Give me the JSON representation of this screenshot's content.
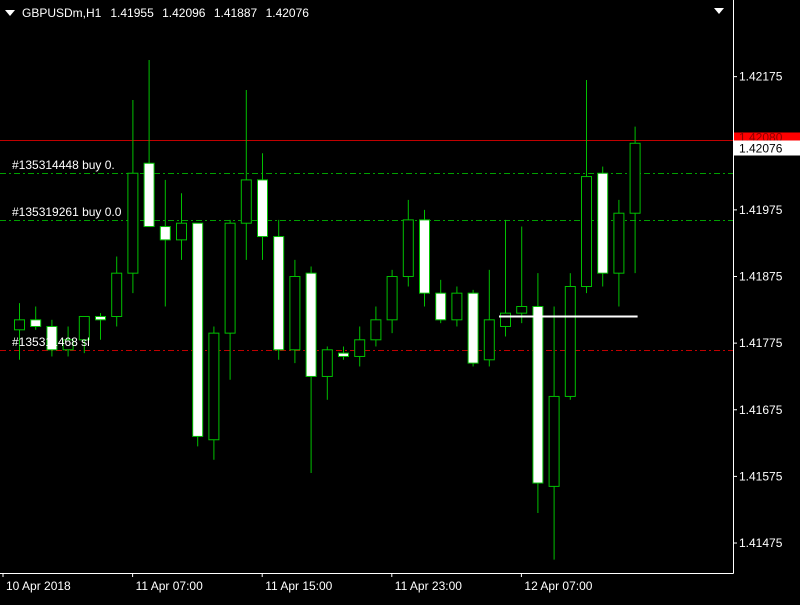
{
  "header": {
    "symbol": "GBPUSDm,H1",
    "open": "1.41955",
    "high": "1.42096",
    "low": "1.41887",
    "close": "1.42076"
  },
  "colors": {
    "background": "#000000",
    "candle_outline": "#00C000",
    "bull_body": "#000000",
    "bear_body": "#FFFFFF",
    "axis": "#FFFFFF",
    "order_line": "#00A000",
    "sl_line": "#C00000",
    "bid_line": "#C00000",
    "bid_label_bg": "#FF0000",
    "current_label_bg": "#FFFFFF"
  },
  "order_labels": [
    {
      "text": "#135314448 buy 0.",
      "line_price": 1.4203,
      "style": "order"
    },
    {
      "text": "#135319261 buy 0.0",
      "line_price": 1.4196,
      "style": "order"
    },
    {
      "text": "#135311468 sl",
      "line_price": 1.41765,
      "style": "sl"
    }
  ],
  "price_labels": {
    "bid": "1.42080",
    "current": "1.42076"
  },
  "chart_data": {
    "type": "candlestick",
    "symbol": "GBPUSDm",
    "timeframe": "H1",
    "y_ticks": [
      1.42175,
      1.42075,
      1.41975,
      1.41875,
      1.41775,
      1.41675,
      1.41575,
      1.41475
    ],
    "y_tick_labels": [
      "1.42175",
      "1.42075",
      "1.41975",
      "1.41875",
      "1.41775",
      "1.41675",
      "1.41575",
      "1.41475"
    ],
    "ylim": [
      1.4143,
      1.4226
    ],
    "x_labels": [
      {
        "label": "10 Apr 2018",
        "index": 0
      },
      {
        "label": "11 Apr 07:00",
        "index": 8
      },
      {
        "label": "11 Apr 15:00",
        "index": 16
      },
      {
        "label": "11 Apr 23:00",
        "index": 24
      },
      {
        "label": "12 Apr 07:00",
        "index": 32
      }
    ],
    "candles": [
      {
        "o": 1.41795,
        "h": 1.41835,
        "l": 1.4175,
        "c": 1.4181
      },
      {
        "o": 1.4181,
        "h": 1.4183,
        "l": 1.41795,
        "c": 1.418
      },
      {
        "o": 1.418,
        "h": 1.4181,
        "l": 1.41755,
        "c": 1.41765
      },
      {
        "o": 1.41765,
        "h": 1.418,
        "l": 1.41755,
        "c": 1.4178
      },
      {
        "o": 1.4178,
        "h": 1.41815,
        "l": 1.4176,
        "c": 1.41815
      },
      {
        "o": 1.41815,
        "h": 1.4182,
        "l": 1.4178,
        "c": 1.4181
      },
      {
        "o": 1.41815,
        "h": 1.41905,
        "l": 1.418,
        "c": 1.4188
      },
      {
        "o": 1.4188,
        "h": 1.4214,
        "l": 1.4185,
        "c": 1.4203
      },
      {
        "o": 1.42045,
        "h": 1.422,
        "l": 1.4195,
        "c": 1.4195
      },
      {
        "o": 1.4195,
        "h": 1.4202,
        "l": 1.4183,
        "c": 1.4193
      },
      {
        "o": 1.4193,
        "h": 1.42,
        "l": 1.419,
        "c": 1.41955
      },
      {
        "o": 1.41955,
        "h": 1.41955,
        "l": 1.4162,
        "c": 1.41635
      },
      {
        "o": 1.4163,
        "h": 1.418,
        "l": 1.416,
        "c": 1.4179
      },
      {
        "o": 1.4179,
        "h": 1.4196,
        "l": 1.4172,
        "c": 1.41955
      },
      {
        "o": 1.41955,
        "h": 1.42155,
        "l": 1.419,
        "c": 1.4202
      },
      {
        "o": 1.4202,
        "h": 1.4206,
        "l": 1.419,
        "c": 1.41935
      },
      {
        "o": 1.41935,
        "h": 1.4196,
        "l": 1.4175,
        "c": 1.41765
      },
      {
        "o": 1.41765,
        "h": 1.419,
        "l": 1.41745,
        "c": 1.41875
      },
      {
        "o": 1.4188,
        "h": 1.4189,
        "l": 1.4158,
        "c": 1.41725
      },
      {
        "o": 1.41725,
        "h": 1.4177,
        "l": 1.4169,
        "c": 1.41765
      },
      {
        "o": 1.4176,
        "h": 1.4177,
        "l": 1.4175,
        "c": 1.41755
      },
      {
        "o": 1.41755,
        "h": 1.418,
        "l": 1.4174,
        "c": 1.4178
      },
      {
        "o": 1.4178,
        "h": 1.4183,
        "l": 1.4177,
        "c": 1.4181
      },
      {
        "o": 1.4181,
        "h": 1.41885,
        "l": 1.4179,
        "c": 1.41875
      },
      {
        "o": 1.41875,
        "h": 1.4199,
        "l": 1.4186,
        "c": 1.4196
      },
      {
        "o": 1.4196,
        "h": 1.41975,
        "l": 1.4183,
        "c": 1.4185
      },
      {
        "o": 1.4185,
        "h": 1.4187,
        "l": 1.41805,
        "c": 1.4181
      },
      {
        "o": 1.4181,
        "h": 1.4186,
        "l": 1.418,
        "c": 1.4185
      },
      {
        "o": 1.4185,
        "h": 1.41855,
        "l": 1.4174,
        "c": 1.41745
      },
      {
        "o": 1.4175,
        "h": 1.41885,
        "l": 1.4174,
        "c": 1.4181
      },
      {
        "o": 1.418,
        "h": 1.4196,
        "l": 1.41785,
        "c": 1.4182
      },
      {
        "o": 1.4182,
        "h": 1.4195,
        "l": 1.41805,
        "c": 1.4183
      },
      {
        "o": 1.4183,
        "h": 1.4188,
        "l": 1.4152,
        "c": 1.41565
      },
      {
        "o": 1.4156,
        "h": 1.4183,
        "l": 1.4145,
        "c": 1.41695
      },
      {
        "o": 1.41695,
        "h": 1.4188,
        "l": 1.4169,
        "c": 1.4186
      },
      {
        "o": 1.4186,
        "h": 1.4217,
        "l": 1.4185,
        "c": 1.42025
      },
      {
        "o": 1.4203,
        "h": 1.4204,
        "l": 1.4186,
        "c": 1.4188
      },
      {
        "o": 1.4188,
        "h": 1.4199,
        "l": 1.4183,
        "c": 1.4197
      },
      {
        "o": 1.4197,
        "h": 1.421,
        "l": 1.4188,
        "c": 1.42075
      }
    ],
    "white_line_price": 1.41815,
    "grid": false,
    "legend": "none"
  }
}
